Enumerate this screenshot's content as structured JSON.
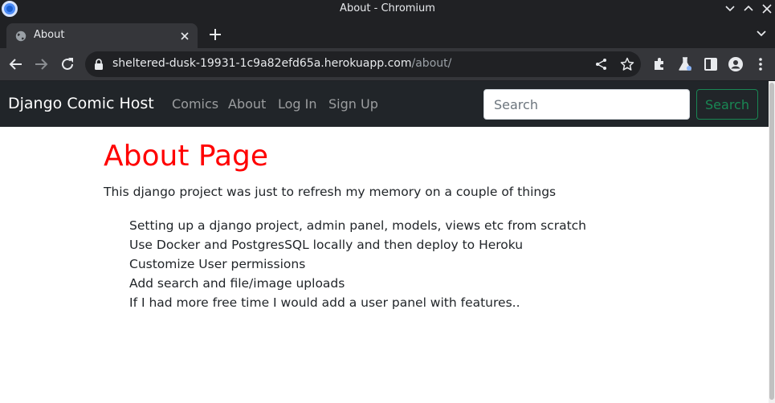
{
  "window": {
    "title": "About - Chromium"
  },
  "tabs": [
    {
      "title": "About",
      "icon": "globe-icon",
      "active": true
    }
  ],
  "omnibox": {
    "url_host": "sheltered-dusk-19931-1c9a82efd65a.herokuapp.com",
    "url_path": "/about/"
  },
  "navbar": {
    "brand": "Django Comic Host",
    "links": [
      "Comics",
      "About",
      "Log In",
      "Sign Up"
    ],
    "search_placeholder": "Search",
    "search_button": "Search"
  },
  "main": {
    "heading": "About Page",
    "intro": "This django project was just to refresh my memory on a couple of things",
    "items": [
      "Setting up a django project, admin panel, models, views etc from scratch",
      "Use Docker and PostgresSQL locally and then deploy to Heroku",
      "Customize User permissions",
      "Add search and file/image uploads",
      "If I had more free time I would add a user panel with features.."
    ]
  },
  "colors": {
    "heading": "#ff0000",
    "navbar_bg": "#212529",
    "search_button": "#198754",
    "browser_frame": "#202124",
    "browser_toolbar": "#35363a"
  }
}
